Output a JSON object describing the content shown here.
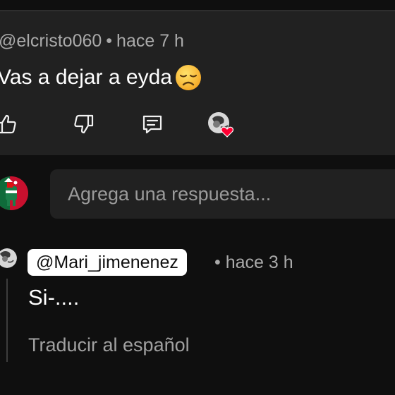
{
  "top_comment": {
    "author": "@elcristo060",
    "separator": "•",
    "time": "hace 7 h",
    "text": "Vas a dejar a eyda",
    "emoji": "disappointed-face-emoji",
    "actions": [
      "like-icon",
      "dislike-icon",
      "reply-icon",
      "creator-heart-icon"
    ]
  },
  "reply_input": {
    "placeholder": "Agrega una respuesta..."
  },
  "reply": {
    "author": "@Mari_jimenenez",
    "time": "• hace 3 h",
    "text": "Si-....",
    "translate_label": "Traducir al español"
  },
  "colors": {
    "background": "#0f0f0f",
    "card": "#212121",
    "muted_text": "#aaaaaa",
    "heart": "#ff0033"
  }
}
